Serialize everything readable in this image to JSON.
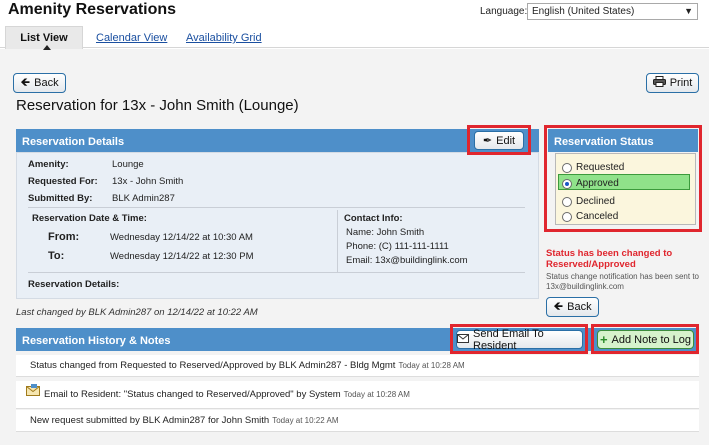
{
  "header": {
    "app_title": "Amenity Reservations",
    "language_label": "Language:",
    "language_value": "English (United States)"
  },
  "tabs": [
    {
      "label": "List View",
      "active": true
    },
    {
      "label": "Calendar View",
      "active": false
    },
    {
      "label": "Availability Grid",
      "active": false
    }
  ],
  "toolbar": {
    "back_label": "Back",
    "print_label": "Print"
  },
  "page_title": "Reservation for 13x - John Smith (Lounge)",
  "details": {
    "header": "Reservation Details",
    "edit_label": "Edit",
    "amenity_label": "Amenity:",
    "amenity_value": "Lounge",
    "requested_for_label": "Requested For:",
    "requested_for_value": "13x - John Smith",
    "submitted_by_label": "Submitted By:",
    "submitted_by_value": "BLK Admin287",
    "date_time_label": "Reservation Date & Time:",
    "from_label": "From:",
    "from_value": "Wednesday 12/14/22 at 10:30 AM",
    "to_label": "To:",
    "to_value": "Wednesday 12/14/22 at 12:30 PM",
    "contact_label": "Contact Info:",
    "contact_name": "Name:  John Smith",
    "contact_phone": "Phone:  (C) 111-111-1111",
    "contact_email": "Email:   13x@buildinglink.com",
    "reservation_details_label": "Reservation Details:",
    "last_changed": "Last changed by BLK Admin287 on 12/14/22 at 10:22 AM"
  },
  "status": {
    "header": "Reservation Status",
    "options": [
      "Requested",
      "Approved",
      "Declined",
      "Canceled"
    ],
    "selected": "Approved",
    "changed_message": "Status has been changed to Reserved/Approved",
    "notification_message": "Status change notification has been sent to 13x@buildinglink.com",
    "back_label": "Back"
  },
  "history": {
    "header": "Reservation History & Notes",
    "send_email_label": "Send Email To Resident",
    "add_note_label": "Add Note to Log",
    "entries": [
      {
        "text": "Status changed from Requested to Reserved/Approved by BLK Admin287 - Bldg Mgmt",
        "time": "Today at 10:28 AM",
        "icon": "envelope-icon"
      },
      {
        "text": "Email to Resident: \"Status changed to Reserved/Approved\" by System",
        "time": "Today at 10:28 AM",
        "icon": "envelope-icon"
      },
      {
        "text": "New request submitted by BLK Admin287 for John Smith",
        "time": "Today at 10:22 AM",
        "icon": ""
      }
    ]
  },
  "colors": {
    "panel_header": "#4e8fc9",
    "highlight_red": "#e0262e",
    "approved_green": "#90e28a",
    "status_message_red": "#e0262e"
  }
}
